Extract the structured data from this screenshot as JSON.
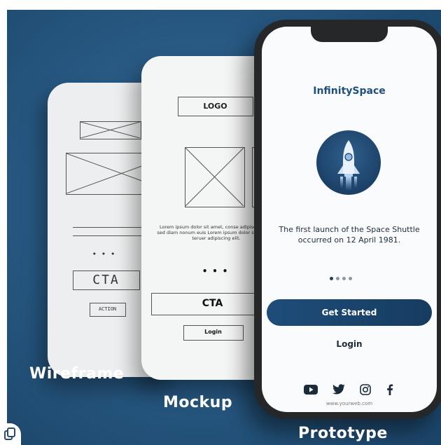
{
  "wireframe": {
    "dots": "• • •",
    "cta_label": "CTA",
    "action_label": "ACTION",
    "caption": "Wireframe"
  },
  "mockup": {
    "logo_label": "LOGO",
    "lorem_text": "Lorem ipsum dolor sit amet, conse adipiscing elit, sed diam nonum euis Lorem ipsum dolor sit amet, c teruer adipiscing elit.",
    "dots": "• • •",
    "cta_label": "CTA",
    "login_label": "Login",
    "caption": "Mockup"
  },
  "prototype": {
    "app_name": "InfinitySpace",
    "description": "The first launch of the Space Shuttle occurred on 12 April 1981.",
    "pager": {
      "count": 4,
      "active_index": 0
    },
    "primary_button_label": "Get Started",
    "secondary_link_label": "Login",
    "social_icons": [
      "youtube-icon",
      "twitter-icon",
      "instagram-icon",
      "facebook-icon"
    ],
    "website": "www.yourweb.com",
    "caption": "Prototype"
  },
  "colors": {
    "background": "#285a84",
    "brand": "#1f4f7c",
    "button": "#1e4d7a",
    "phone_frame": "#262729"
  }
}
